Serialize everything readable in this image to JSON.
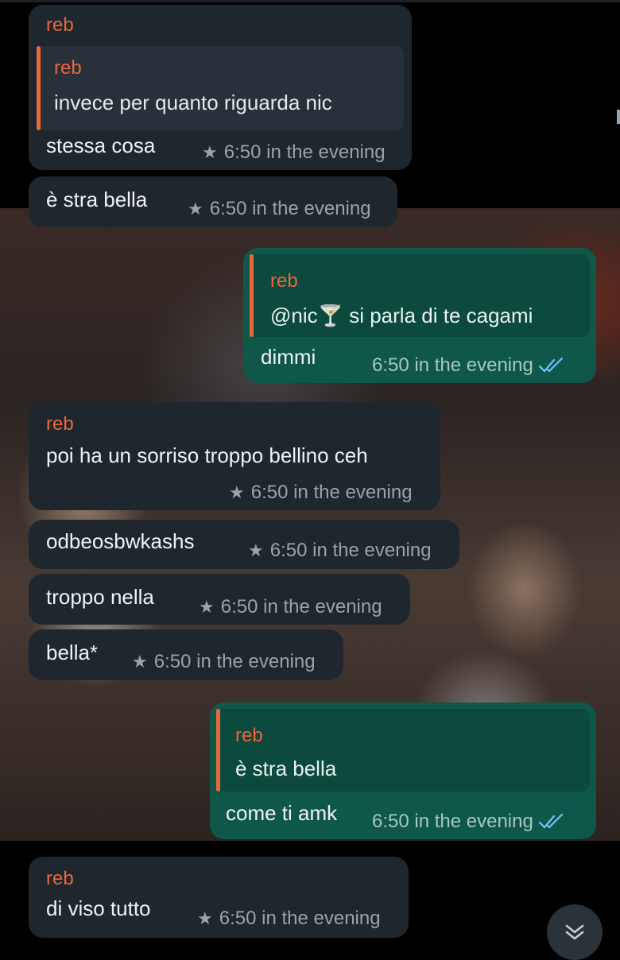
{
  "messages": [
    {
      "sender": "reb",
      "quote_sender": "reb",
      "quote_text": "invece per quanto riguarda nic",
      "text": "stessa cosa",
      "time": "6:50 in the evening",
      "starred": true
    },
    {
      "text": "è stra bella",
      "time": "6:50 in the evening",
      "starred": true
    },
    {
      "outgoing": true,
      "quote_sender": "reb",
      "quote_text": "@nic🍸 si parla di te cagami",
      "text": "dimmi",
      "time": "6:50 in the evening",
      "read": true
    },
    {
      "sender": "reb",
      "text": "poi ha un sorriso troppo bellino ceh",
      "time": "6:50 in the evening",
      "starred": true
    },
    {
      "text": "odbeosbwkashs",
      "time": "6:50 in the evening",
      "starred": true
    },
    {
      "text": "troppo nella",
      "time": "6:50 in the evening",
      "starred": true
    },
    {
      "text": "bella*",
      "time": "6:50 in the evening",
      "starred": true
    },
    {
      "outgoing": true,
      "quote_sender": "reb",
      "quote_text": "è stra bella",
      "text": "come ti amk",
      "time": "6:50 in the evening",
      "read": true
    },
    {
      "sender": "reb",
      "text": "di viso tutto",
      "time": "6:50 in the evening",
      "starred": true
    }
  ],
  "icons": {
    "star": "star-icon",
    "read": "double-check-icon",
    "scroll": "chevron-double-down-icon"
  },
  "colors": {
    "incoming": "#1f272e",
    "outgoing": "#0f5849",
    "sender": "#e9683a",
    "read_check": "#6fc3ff"
  }
}
